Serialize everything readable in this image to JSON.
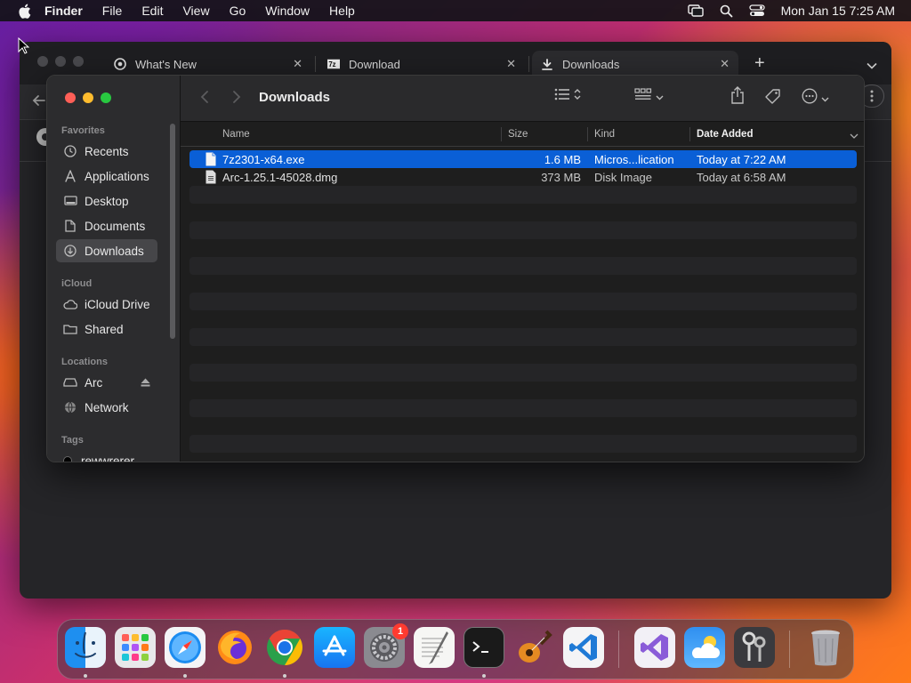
{
  "menubar": {
    "app_name": "Finder",
    "items": [
      "File",
      "Edit",
      "View",
      "Go",
      "Window",
      "Help"
    ],
    "clock": "Mon Jan 15  7:25 AM"
  },
  "browser": {
    "tabs": [
      {
        "title": "What's New",
        "icon": "chrome-icon"
      },
      {
        "title": "Download",
        "icon": "7zip-icon"
      },
      {
        "title": "Downloads",
        "icon": "download-arrow-icon"
      }
    ],
    "close_glyph": "✕",
    "new_tab_glyph": "+"
  },
  "finder": {
    "title": "Downloads",
    "sidebar": {
      "favorites_label": "Favorites",
      "favorites": [
        "Recents",
        "Applications",
        "Desktop",
        "Documents",
        "Downloads"
      ],
      "icloud_label": "iCloud",
      "icloud": [
        "iCloud Drive",
        "Shared"
      ],
      "locations_label": "Locations",
      "locations": [
        "Arc",
        "Network"
      ],
      "tags_label": "Tags",
      "tags": [
        "rewwrerer"
      ]
    },
    "columns": {
      "name": "Name",
      "size": "Size",
      "kind": "Kind",
      "date_added": "Date Added"
    },
    "files": [
      {
        "name": "7z2301-x64.exe",
        "size": "1.6 MB",
        "kind": "Micros...lication",
        "date": "Today at 7:22 AM",
        "selected": true
      },
      {
        "name": "Arc-1.25.1-45028.dmg",
        "size": "373 MB",
        "kind": "Disk Image",
        "date": "Today at 6:58 AM",
        "selected": false
      }
    ],
    "colors": {
      "selection": "#0a5fd6",
      "close": "#ff5f57",
      "minimize": "#febc2e",
      "zoom": "#28c840"
    }
  },
  "dock": {
    "apps": [
      "Finder",
      "Launchpad",
      "Safari",
      "Firefox",
      "Chrome",
      "App Store",
      "System Settings",
      "TextEdit",
      "Terminal",
      "GarageBand",
      "Visual Studio Code",
      "Visual Studio",
      "Weather",
      "Keychain Access",
      "Trash"
    ],
    "settings_badge": "1"
  }
}
